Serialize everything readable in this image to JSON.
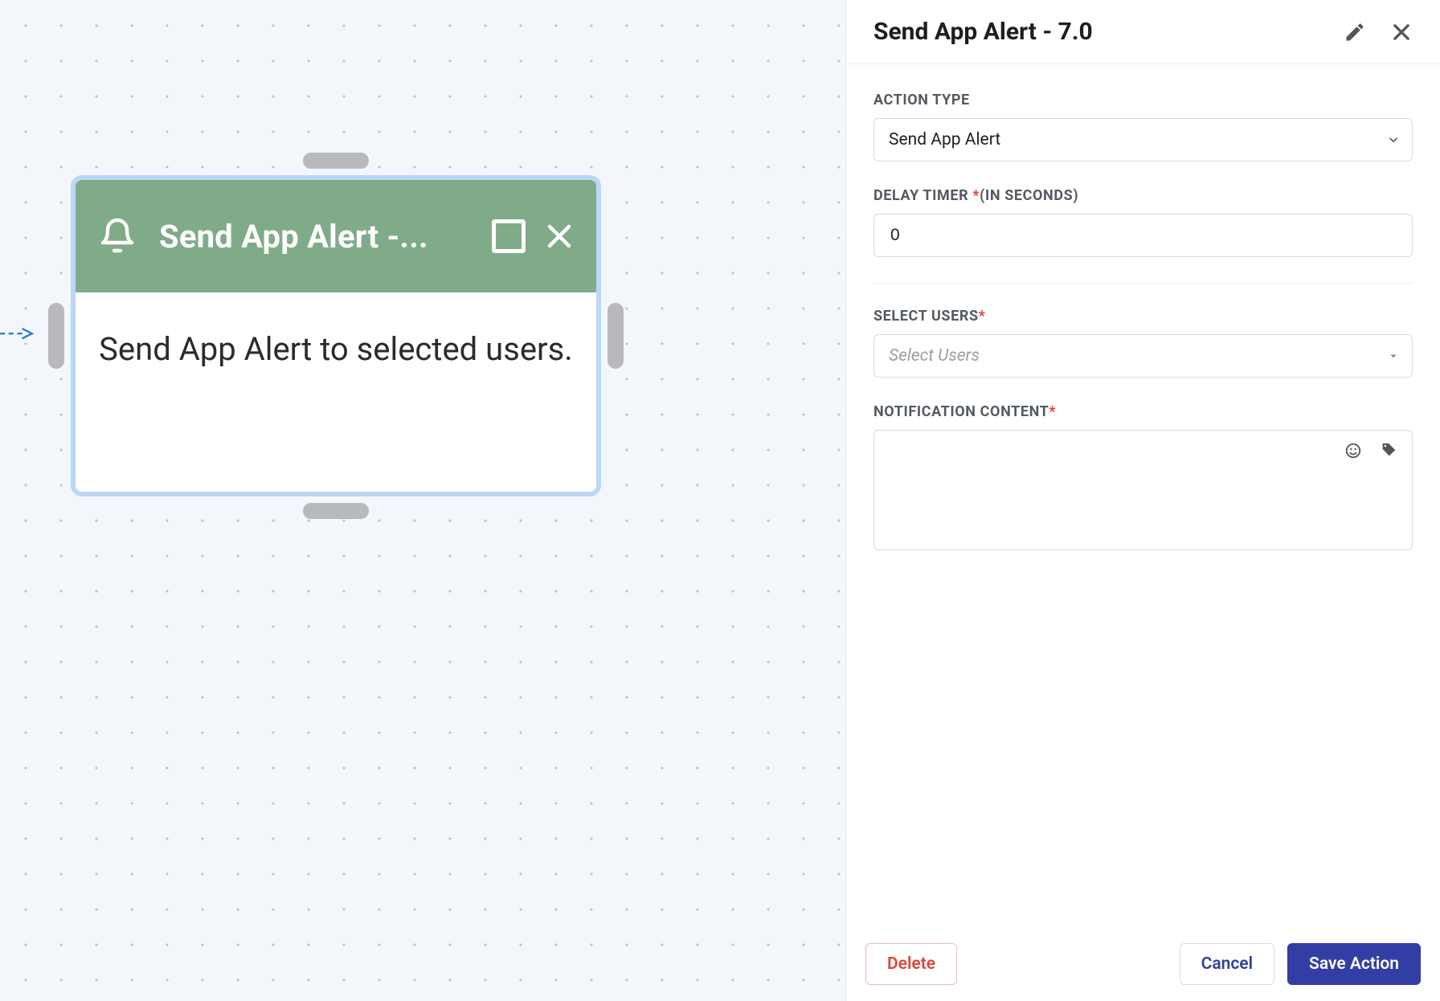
{
  "canvas": {
    "node": {
      "title": "Send App Alert -...",
      "description": "Send App Alert to selected users."
    }
  },
  "panel": {
    "title": "Send App Alert - 7.0",
    "fields": {
      "action_type": {
        "label": "ACTION TYPE",
        "value": "Send App Alert"
      },
      "delay_timer": {
        "label": "DELAY TIMER ",
        "hint": "(IN SECONDS)",
        "value": "0"
      },
      "select_users": {
        "label": "SELECT USERS",
        "placeholder": "Select Users"
      },
      "notification_content": {
        "label": "NOTIFICATION CONTENT"
      }
    },
    "buttons": {
      "delete": "Delete",
      "cancel": "Cancel",
      "save": "Save Action"
    }
  }
}
